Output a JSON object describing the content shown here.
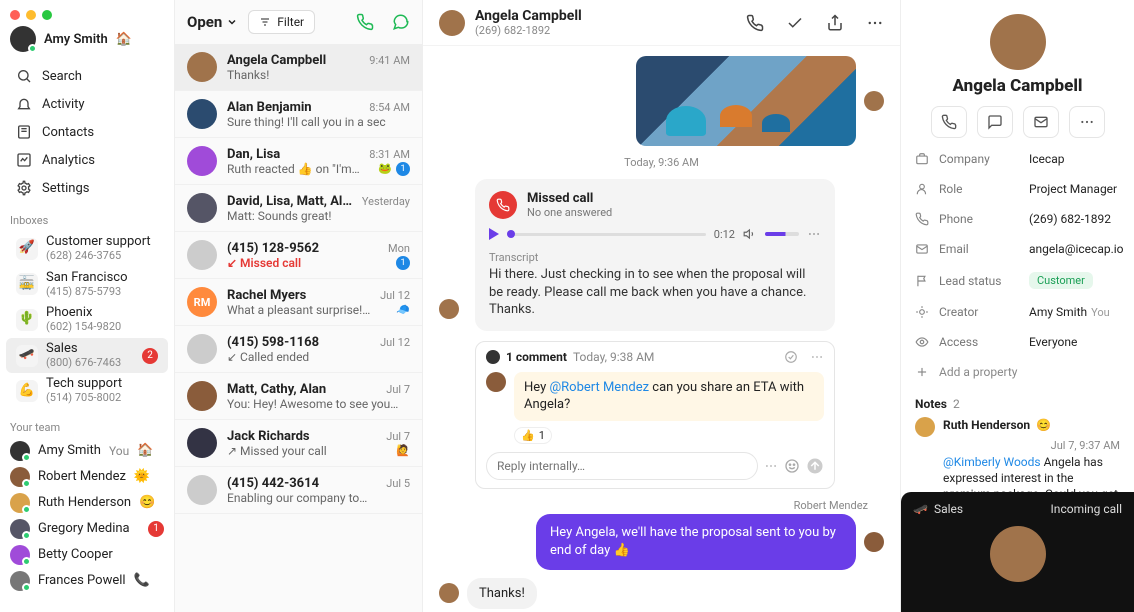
{
  "me": {
    "name": "Amy Smith",
    "emoji": "🏠"
  },
  "nav": {
    "search": "Search",
    "activity": "Activity",
    "contacts": "Contacts",
    "analytics": "Analytics",
    "settings": "Settings"
  },
  "inboxes": {
    "label": "Inboxes",
    "items": [
      {
        "emoji": "🚀",
        "name": "Customer support",
        "phone": "(628) 246-3765"
      },
      {
        "emoji": "🚋",
        "name": "San Francisco",
        "phone": "(415) 875-5793"
      },
      {
        "emoji": "🌵",
        "name": "Phoenix",
        "phone": "(602) 154-9820"
      },
      {
        "emoji": "🛹",
        "name": "Sales",
        "phone": "(800) 676-7463",
        "badge": "2",
        "selected": true
      },
      {
        "emoji": "💪",
        "name": "Tech support",
        "phone": "(514) 705-8002"
      }
    ]
  },
  "team": {
    "label": "Your team",
    "items": [
      {
        "name": "Amy Smith",
        "you": "You",
        "emoji": "🏠"
      },
      {
        "name": "Robert Mendez",
        "emoji": "🌞"
      },
      {
        "name": "Ruth Henderson",
        "emoji": "😊"
      },
      {
        "name": "Gregory Medina",
        "badge": "1"
      },
      {
        "name": "Betty Cooper"
      },
      {
        "name": "Frances Powell",
        "emoji": "📞"
      }
    ]
  },
  "threads_head": {
    "open": "Open",
    "filter": "Filter"
  },
  "threads": [
    {
      "name": "Angela Campbell",
      "preview": "Thanks!",
      "time": "9:41 AM",
      "selected": true
    },
    {
      "name": "Alan Benjamin",
      "preview": "Sure thing! I'll call you in a sec",
      "time": "8:54 AM"
    },
    {
      "name": "Dan, Lisa",
      "preview": "Ruth reacted 👍 on \"I'm…",
      "time": "8:31 AM",
      "trailing_badge": "1",
      "trailing_emoji": "🐸"
    },
    {
      "name": "David, Lisa, Matt, Alan",
      "preview": "Matt: Sounds great!",
      "time": "Yesterday"
    },
    {
      "name": "(415) 128-9562",
      "preview": "↙ Missed call",
      "time": "Mon",
      "preview_red": true,
      "trailing_badge": "1"
    },
    {
      "name": "Rachel Myers",
      "preview": "What a pleasant surprise!…",
      "time": "Jul 12",
      "initials": "RM",
      "trailing_emoji": "🧢"
    },
    {
      "name": "(415) 598-1168",
      "preview": "↙ Called ended",
      "time": "Jul 12"
    },
    {
      "name": "Matt, Cathy, Alan",
      "preview": "You: Hey! Awesome to see you…",
      "time": "Jul 7"
    },
    {
      "name": "Jack Richards",
      "preview": "↗ Missed your call",
      "time": "Jul 7",
      "trailing_emoji": "🙋"
    },
    {
      "name": "(415) 442-3614",
      "preview": "Enabling our company to…",
      "time": "Jul 5"
    }
  ],
  "convo": {
    "name": "Angela Campbell",
    "phone": "(269) 682-1892",
    "daystamp": "Today, 9:36 AM",
    "missed": {
      "title": "Missed call",
      "subtitle": "No one answered",
      "duration": "0:12"
    },
    "transcript_label": "Transcript",
    "transcript": "Hi there. Just checking in to see when the proposal will be ready. Please call me back when you have a chance. Thanks.",
    "comment": {
      "header": "1 comment",
      "when": "Today, 9:38 AM",
      "prefix": "Hey ",
      "mention": "@Robert Mendez",
      "suffix": " can you share an ETA with Angela?",
      "react_emoji": "👍",
      "react_count": "1",
      "reply_placeholder": "Reply internally…"
    },
    "attribution": "Robert Mendez",
    "outgoing": "Hey Angela, we'll have the proposal sent to you by end of day 👍",
    "incoming": "Thanks!"
  },
  "contact": {
    "name": "Angela Campbell",
    "props": {
      "company_k": "Company",
      "company_v": "Icecap",
      "role_k": "Role",
      "role_v": "Project Manager",
      "phone_k": "Phone",
      "phone_v": "(269) 682-1892",
      "email_k": "Email",
      "email_v": "angela@icecap.io",
      "lead_k": "Lead status",
      "lead_v": "Customer",
      "creator_k": "Creator",
      "creator_v": "Amy Smith",
      "creator_you": "You",
      "access_k": "Access",
      "access_v": "Everyone",
      "add": "Add a property"
    },
    "notes_label": "Notes",
    "notes_count": "2",
    "note": {
      "author": "Ruth Henderson",
      "author_emoji": "😊",
      "when": "Jul 7, 9:37 AM",
      "mention": "@Kimberly Woods",
      "text": " Angela has expressed interest in the premium package. Could you get a quote together for her?"
    }
  },
  "toast": {
    "label": "Sales",
    "status": "Incoming call",
    "emoji": "🛹"
  }
}
